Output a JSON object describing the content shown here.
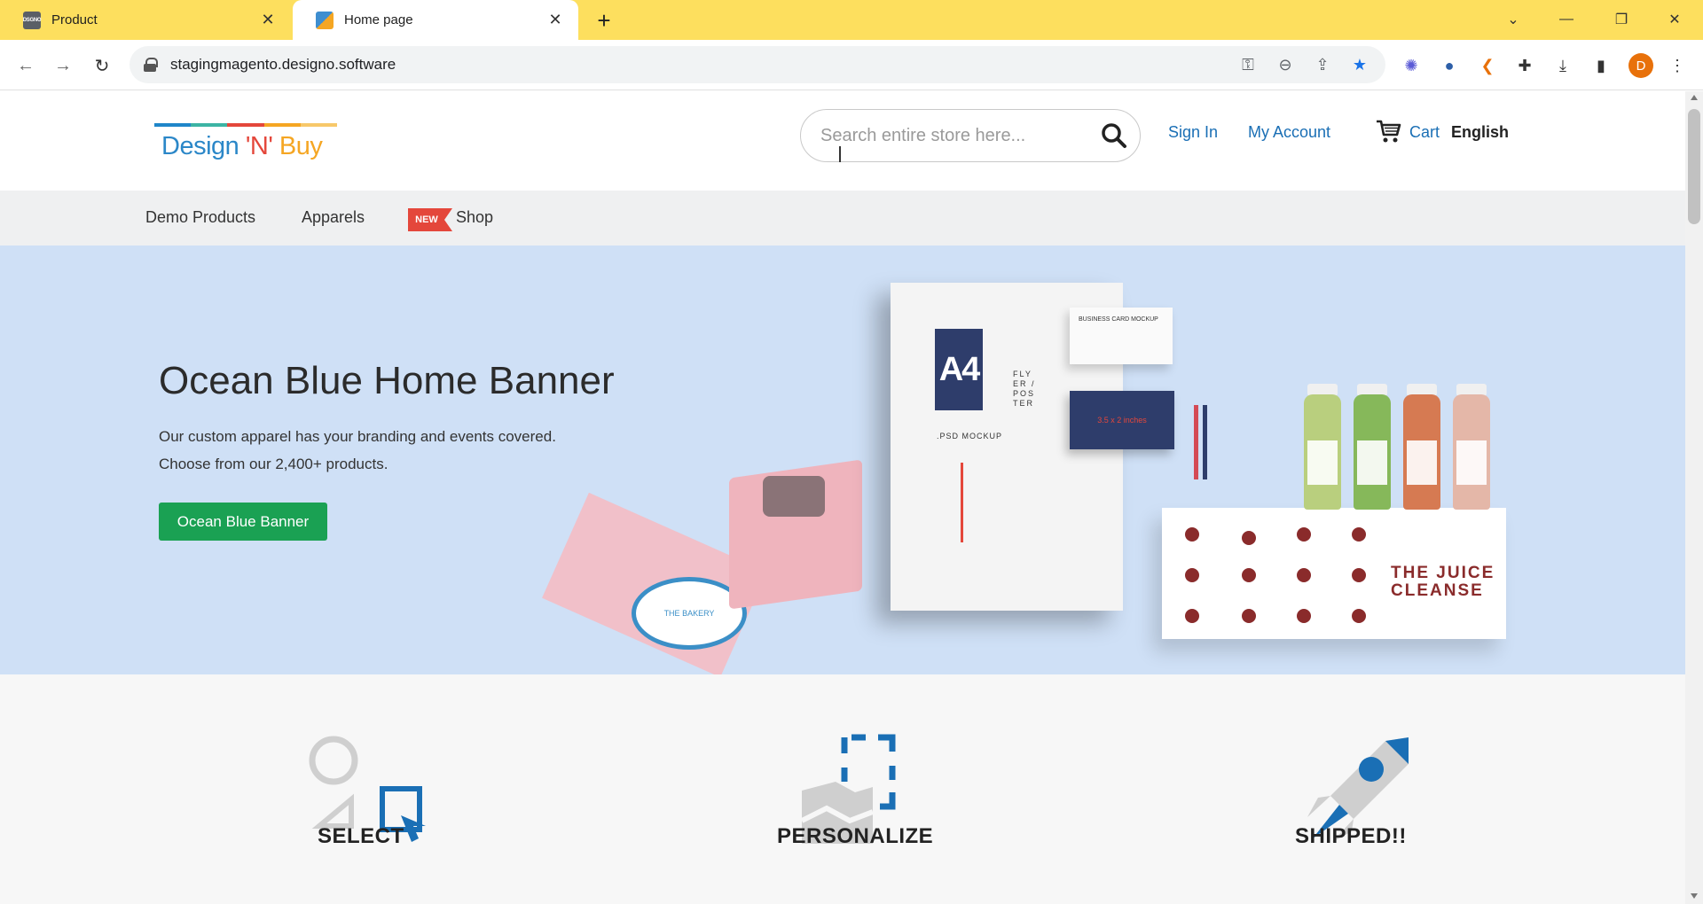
{
  "browser": {
    "tabs": [
      {
        "title": "Product",
        "favicon": "DSGNO",
        "active": false
      },
      {
        "title": "Home page",
        "active": true
      }
    ],
    "url": "stagingmagento.designo.software",
    "profile_initial": "D"
  },
  "header": {
    "logo": {
      "design": "Design",
      "n": " 'N' ",
      "buy": "Buy"
    },
    "search_placeholder": "Search entire store here...",
    "sign_in": "Sign In",
    "my_account": "My Account",
    "cart": "Cart",
    "language": "English"
  },
  "nav": {
    "items": [
      "Demo Products",
      "Apparels",
      "Shop"
    ],
    "new_badge": "NEW"
  },
  "banner": {
    "title": "Ocean Blue Home Banner",
    "text": "Our custom apparel has your branding and events covered. Choose from our 2,400+ products.",
    "button": "Ocean Blue Banner",
    "art": {
      "a4": "A4",
      "flyer": "FLY ER / POS TER",
      "psd": ".PSD MOCKUP",
      "business_card": "BUSINESS CARD MOCKUP",
      "card_size": "3.5 x 2 inches",
      "bakery": "THE BAKERY",
      "juice": "THE JUICE CLEANSE"
    }
  },
  "features": [
    {
      "title": "SELECT"
    },
    {
      "title": "PERSONALIZE"
    },
    {
      "title": "SHIPPED!!"
    }
  ],
  "colors": {
    "tabbar": "#fddf5e",
    "link": "#1a6fb5",
    "banner_bg": "#cfe0f6",
    "button_green": "#1aa153",
    "badge_red": "#e4473b",
    "accent_blue": "#1a6fb5"
  }
}
